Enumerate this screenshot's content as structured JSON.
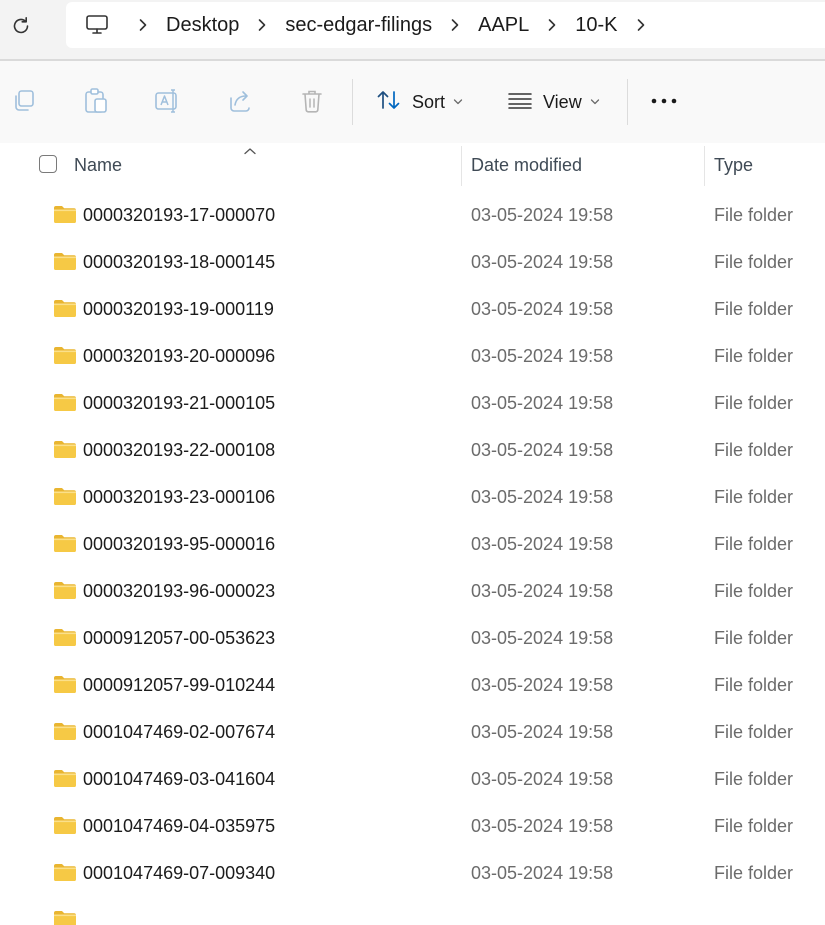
{
  "address_bar": {
    "refresh_icon": "refresh-icon",
    "computer_icon": "monitor-icon",
    "breadcrumbs": [
      "Desktop",
      "sec-edgar-filings",
      "AAPL",
      "10-K"
    ]
  },
  "toolbar": {
    "icons": [
      "copy-icon",
      "paste-icon",
      "rename-icon",
      "share-icon",
      "delete-icon"
    ],
    "sort_label": "Sort",
    "view_label": "View",
    "more_icon": "more-icon"
  },
  "columns": {
    "name": "Name",
    "date_modified": "Date modified",
    "type": "Type"
  },
  "files": [
    {
      "name": "0000320193-17-000070",
      "date": "03-05-2024 19:58",
      "type": "File folder"
    },
    {
      "name": "0000320193-18-000145",
      "date": "03-05-2024 19:58",
      "type": "File folder"
    },
    {
      "name": "0000320193-19-000119",
      "date": "03-05-2024 19:58",
      "type": "File folder"
    },
    {
      "name": "0000320193-20-000096",
      "date": "03-05-2024 19:58",
      "type": "File folder"
    },
    {
      "name": "0000320193-21-000105",
      "date": "03-05-2024 19:58",
      "type": "File folder"
    },
    {
      "name": "0000320193-22-000108",
      "date": "03-05-2024 19:58",
      "type": "File folder"
    },
    {
      "name": "0000320193-23-000106",
      "date": "03-05-2024 19:58",
      "type": "File folder"
    },
    {
      "name": "0000320193-95-000016",
      "date": "03-05-2024 19:58",
      "type": "File folder"
    },
    {
      "name": "0000320193-96-000023",
      "date": "03-05-2024 19:58",
      "type": "File folder"
    },
    {
      "name": "0000912057-00-053623",
      "date": "03-05-2024 19:58",
      "type": "File folder"
    },
    {
      "name": "0000912057-99-010244",
      "date": "03-05-2024 19:58",
      "type": "File folder"
    },
    {
      "name": "0001047469-02-007674",
      "date": "03-05-2024 19:58",
      "type": "File folder"
    },
    {
      "name": "0001047469-03-041604",
      "date": "03-05-2024 19:58",
      "type": "File folder"
    },
    {
      "name": "0001047469-04-035975",
      "date": "03-05-2024 19:58",
      "type": "File folder"
    },
    {
      "name": "0001047469-07-009340",
      "date": "03-05-2024 19:58",
      "type": "File folder"
    },
    {
      "name": "",
      "date": "",
      "type": ""
    }
  ],
  "colors": {
    "folder_fill": "#f6c945",
    "folder_tab": "#e9b530",
    "accent": "#0067c0"
  }
}
